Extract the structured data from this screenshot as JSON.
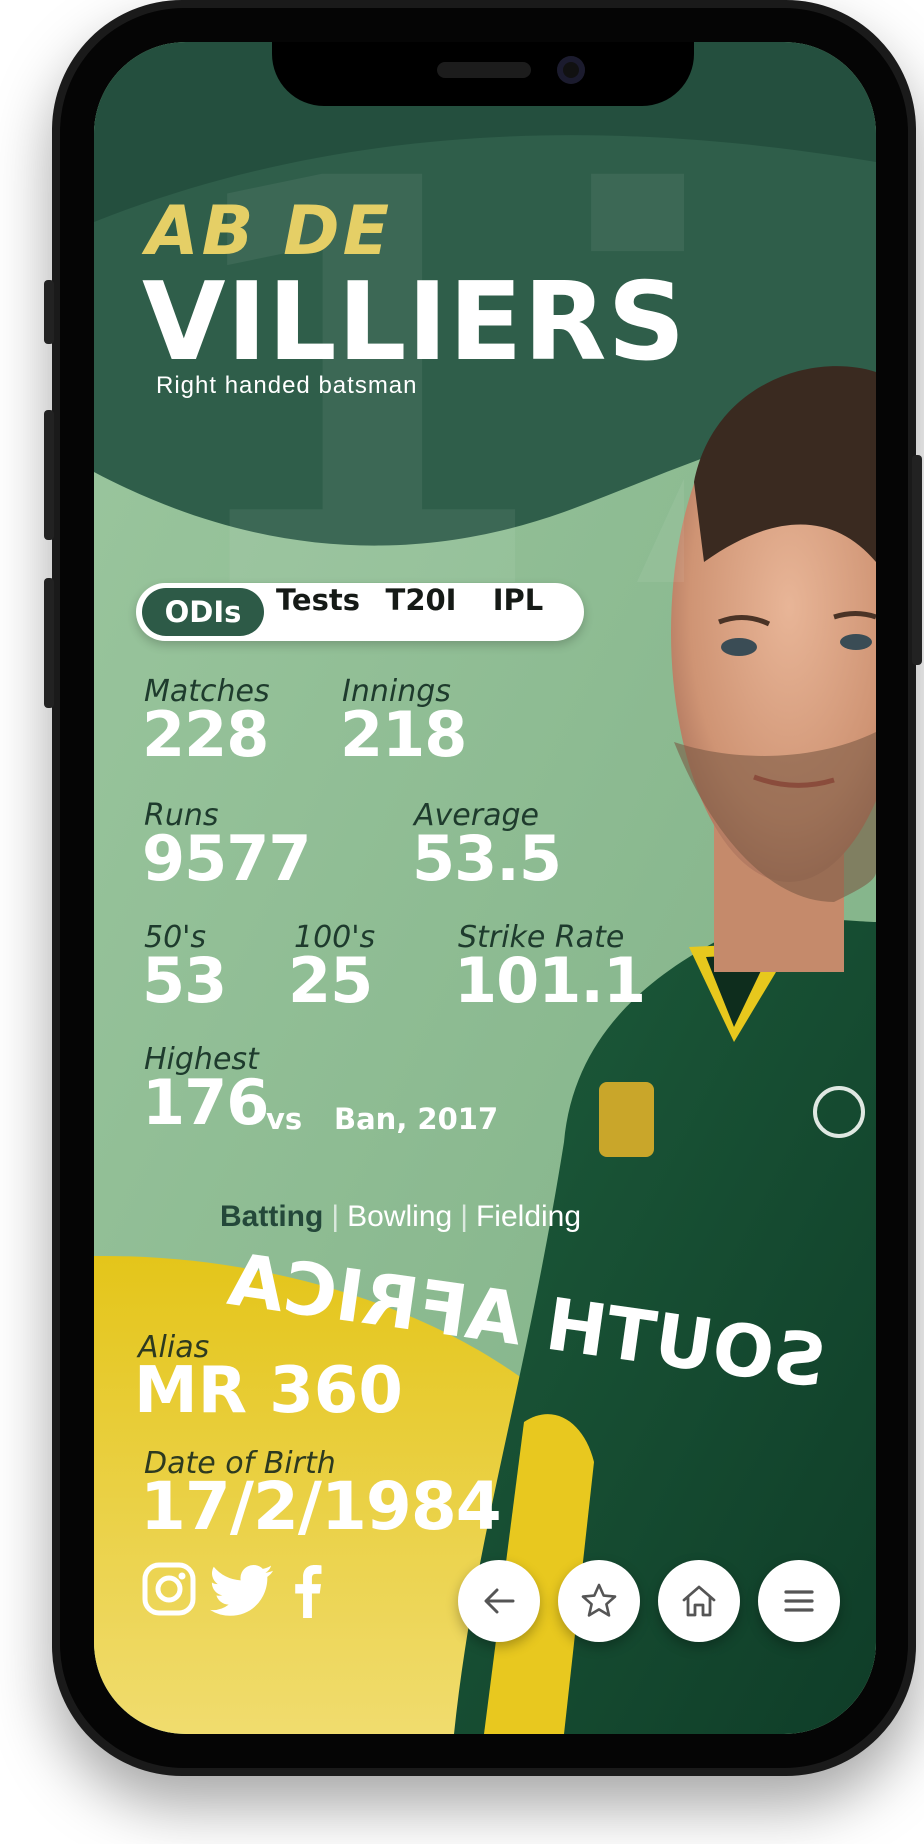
{
  "player": {
    "first_name": "AB DE",
    "last_name": "VILLIERS",
    "role": "Right handed batsman",
    "jersey_number": "17"
  },
  "format_tabs": [
    "ODIs",
    "Tests",
    "T20I",
    "IPL"
  ],
  "active_format": "ODIs",
  "stats": {
    "matches_label": "Matches",
    "matches": "228",
    "innings_label": "Innings",
    "innings": "218",
    "runs_label": "Runs",
    "runs": "9577",
    "average_label": "Average",
    "average": "53.5",
    "fifties_label": "50's",
    "fifties": "53",
    "hundreds_label": "100's",
    "hundreds": "25",
    "strike_rate_label": "Strike Rate",
    "strike_rate": "101.1",
    "highest_label": "Highest",
    "highest": "176",
    "highest_vs": "vs",
    "highest_opponent": "Ban, 2017"
  },
  "category_tabs": {
    "batting": "Batting",
    "bowling": "Bowling",
    "fielding": "Fielding",
    "separator": "|",
    "active": "Batting"
  },
  "profile": {
    "alias_label": "Alias",
    "alias": "MR 360",
    "dob_label": "Date of Birth",
    "dob": "17/2/1984"
  },
  "social_icons": [
    "instagram-icon",
    "twitter-icon",
    "facebook-icon"
  ],
  "nav_icons": [
    "back-arrow-icon",
    "star-icon",
    "home-icon",
    "menu-icon"
  ],
  "colors": {
    "dark_green": "#2d5a47",
    "sage_green": "#89b98e",
    "yellow": "#e7c81d",
    "gold_text": "#e5cf66",
    "white": "#ffffff"
  }
}
